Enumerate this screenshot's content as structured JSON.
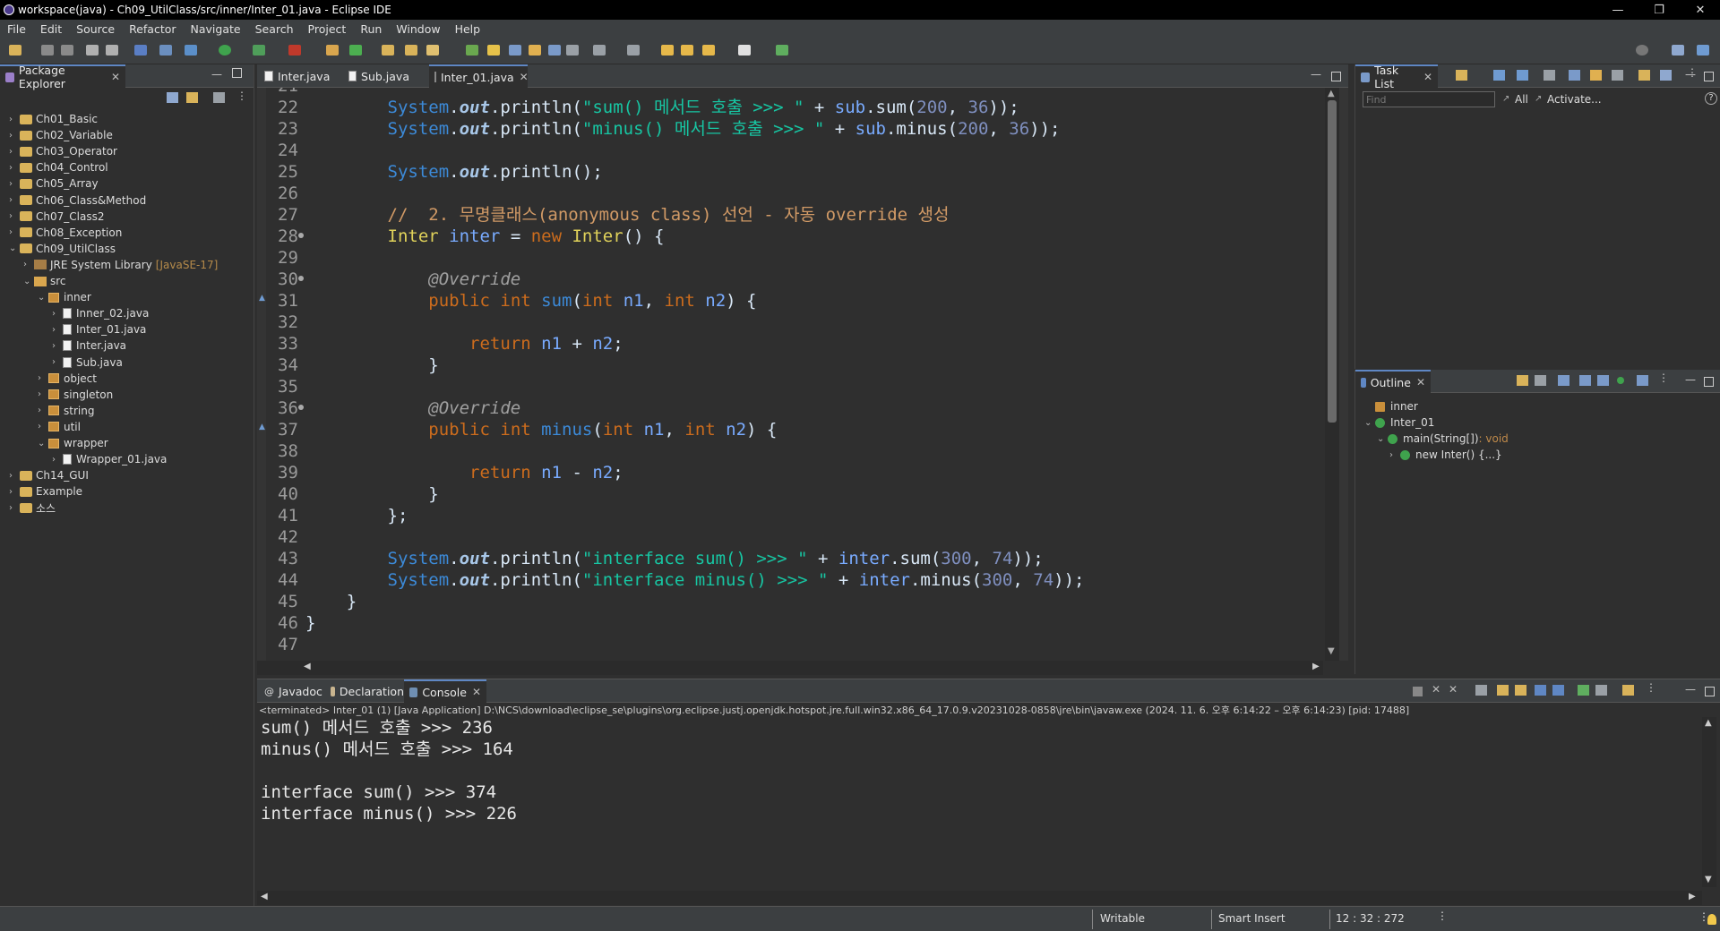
{
  "window": {
    "title": "workspace(java) - Ch09_UtilClass/src/inner/Inter_01.java - Eclipse IDE",
    "minimize": "—",
    "maximize": "❐",
    "close": "✕"
  },
  "menu": [
    "File",
    "Edit",
    "Source",
    "Refactor",
    "Navigate",
    "Search",
    "Project",
    "Run",
    "Window",
    "Help"
  ],
  "package_explorer": {
    "title": "Package Explorer",
    "items": [
      {
        "label": "Ch01_Basic",
        "type": "project",
        "expanded": false
      },
      {
        "label": "Ch02_Variable",
        "type": "project",
        "expanded": false
      },
      {
        "label": "Ch03_Operator",
        "type": "project",
        "expanded": false
      },
      {
        "label": "Ch04_Control",
        "type": "project",
        "expanded": false
      },
      {
        "label": "Ch05_Array",
        "type": "project",
        "expanded": false
      },
      {
        "label": "Ch06_Class&Method",
        "type": "project",
        "expanded": false
      },
      {
        "label": "Ch07_Class2",
        "type": "project",
        "expanded": false
      },
      {
        "label": "Ch08_Exception",
        "type": "project",
        "expanded": false
      },
      {
        "label": "Ch09_UtilClass",
        "type": "project",
        "expanded": true
      },
      {
        "label": "JRE System Library",
        "suffix": "[JavaSE-17]",
        "type": "jre",
        "expanded": false
      },
      {
        "label": "src",
        "type": "src",
        "expanded": true
      },
      {
        "label": "inner",
        "type": "package",
        "expanded": true
      },
      {
        "label": "Inner_02.java",
        "type": "file",
        "expanded": false
      },
      {
        "label": "Inter_01.java",
        "type": "file",
        "expanded": false
      },
      {
        "label": "Inter.java",
        "type": "file",
        "expanded": false
      },
      {
        "label": "Sub.java",
        "type": "file",
        "expanded": false
      },
      {
        "label": "object",
        "type": "package",
        "expanded": false
      },
      {
        "label": "singleton",
        "type": "package",
        "expanded": false
      },
      {
        "label": "string",
        "type": "package",
        "expanded": false
      },
      {
        "label": "util",
        "type": "package",
        "expanded": false
      },
      {
        "label": "wrapper",
        "type": "package",
        "expanded": true
      },
      {
        "label": "Wrapper_01.java",
        "type": "file",
        "expanded": false
      },
      {
        "label": "Ch14_GUI",
        "type": "project",
        "expanded": false
      },
      {
        "label": "Example",
        "type": "project",
        "expanded": false
      },
      {
        "label": "소스",
        "type": "project",
        "expanded": false
      }
    ]
  },
  "editor_tabs": [
    "Inter.java",
    "Sub.java",
    "Inter_01.java"
  ],
  "code_lines": [
    {
      "n": "21",
      "tokens": []
    },
    {
      "n": "22",
      "tokens": [
        [
          "        ",
          ""
        ],
        [
          "System",
          "cls"
        ],
        [
          ".",
          ""
        ],
        [
          "out",
          "fld"
        ],
        [
          ".println(",
          ""
        ],
        [
          "\"sum() 메서드 호출 >>> \"",
          "str"
        ],
        [
          " + ",
          ""
        ],
        [
          "sub",
          "var"
        ],
        [
          ".sum(",
          ""
        ],
        [
          "200",
          "num"
        ],
        [
          ", ",
          ""
        ],
        [
          "36",
          "num"
        ],
        [
          "));",
          ""
        ]
      ]
    },
    {
      "n": "23",
      "tokens": [
        [
          "        ",
          ""
        ],
        [
          "System",
          "cls"
        ],
        [
          ".",
          ""
        ],
        [
          "out",
          "fld"
        ],
        [
          ".println(",
          ""
        ],
        [
          "\"minus() 메서드 호출 >>> \"",
          "str"
        ],
        [
          " + ",
          ""
        ],
        [
          "sub",
          "var"
        ],
        [
          ".minus(",
          ""
        ],
        [
          "200",
          "num"
        ],
        [
          ", ",
          ""
        ],
        [
          "36",
          "num"
        ],
        [
          "));",
          ""
        ]
      ]
    },
    {
      "n": "24",
      "tokens": []
    },
    {
      "n": "25",
      "tokens": [
        [
          "        ",
          ""
        ],
        [
          "System",
          "cls"
        ],
        [
          ".",
          ""
        ],
        [
          "out",
          "fld"
        ],
        [
          ".println();",
          ""
        ]
      ]
    },
    {
      "n": "26",
      "tokens": []
    },
    {
      "n": "27",
      "tokens": [
        [
          "        ",
          ""
        ],
        [
          "//  2. 무명클래스(anonymous class) 선언 - 자동 override 생성",
          "com"
        ]
      ]
    },
    {
      "n": "28",
      "tokens": [
        [
          "        ",
          ""
        ],
        [
          "Inter",
          "type"
        ],
        [
          " ",
          ""
        ],
        [
          "inter",
          "var"
        ],
        [
          " = ",
          ""
        ],
        [
          "new",
          "kw"
        ],
        [
          " ",
          ""
        ],
        [
          "Inter",
          "type"
        ],
        [
          "() {",
          ""
        ]
      ]
    },
    {
      "n": "29",
      "tokens": []
    },
    {
      "n": "30",
      "tokens": [
        [
          "            ",
          ""
        ],
        [
          "@Override",
          "ann"
        ]
      ]
    },
    {
      "n": "31",
      "tokens": [
        [
          "            ",
          ""
        ],
        [
          "public",
          "kw"
        ],
        [
          " ",
          ""
        ],
        [
          "int",
          "kw"
        ],
        [
          " ",
          ""
        ],
        [
          "sum",
          "cls"
        ],
        [
          "(",
          ""
        ],
        [
          "int",
          "kw"
        ],
        [
          " ",
          ""
        ],
        [
          "n1",
          "var"
        ],
        [
          ", ",
          ""
        ],
        [
          "int",
          "kw"
        ],
        [
          " ",
          ""
        ],
        [
          "n2",
          "var"
        ],
        [
          ") {",
          ""
        ]
      ]
    },
    {
      "n": "32",
      "tokens": []
    },
    {
      "n": "33",
      "tokens": [
        [
          "                ",
          ""
        ],
        [
          "return",
          "kw"
        ],
        [
          " ",
          ""
        ],
        [
          "n1",
          "var"
        ],
        [
          " + ",
          ""
        ],
        [
          "n2",
          "var"
        ],
        [
          ";",
          ""
        ]
      ]
    },
    {
      "n": "34",
      "tokens": [
        [
          "            }",
          ""
        ]
      ]
    },
    {
      "n": "35",
      "tokens": []
    },
    {
      "n": "36",
      "tokens": [
        [
          "            ",
          ""
        ],
        [
          "@Override",
          "ann"
        ]
      ]
    },
    {
      "n": "37",
      "tokens": [
        [
          "            ",
          ""
        ],
        [
          "public",
          "kw"
        ],
        [
          " ",
          ""
        ],
        [
          "int",
          "kw"
        ],
        [
          " ",
          ""
        ],
        [
          "minus",
          "cls"
        ],
        [
          "(",
          ""
        ],
        [
          "int",
          "kw"
        ],
        [
          " ",
          ""
        ],
        [
          "n1",
          "var"
        ],
        [
          ", ",
          ""
        ],
        [
          "int",
          "kw"
        ],
        [
          " ",
          ""
        ],
        [
          "n2",
          "var"
        ],
        [
          ") {",
          ""
        ]
      ]
    },
    {
      "n": "38",
      "tokens": []
    },
    {
      "n": "39",
      "tokens": [
        [
          "                ",
          ""
        ],
        [
          "return",
          "kw"
        ],
        [
          " ",
          ""
        ],
        [
          "n1",
          "var"
        ],
        [
          " - ",
          ""
        ],
        [
          "n2",
          "var"
        ],
        [
          ";",
          ""
        ]
      ]
    },
    {
      "n": "40",
      "tokens": [
        [
          "            }",
          ""
        ]
      ]
    },
    {
      "n": "41",
      "tokens": [
        [
          "        };",
          ""
        ]
      ]
    },
    {
      "n": "42",
      "tokens": []
    },
    {
      "n": "43",
      "tokens": [
        [
          "        ",
          ""
        ],
        [
          "System",
          "cls"
        ],
        [
          ".",
          ""
        ],
        [
          "out",
          "fld"
        ],
        [
          ".println(",
          ""
        ],
        [
          "\"interface sum() >>> \"",
          "str"
        ],
        [
          " + ",
          ""
        ],
        [
          "inter",
          "var"
        ],
        [
          ".sum(",
          ""
        ],
        [
          "300",
          "num"
        ],
        [
          ", ",
          ""
        ],
        [
          "74",
          "num"
        ],
        [
          "));",
          ""
        ]
      ]
    },
    {
      "n": "44",
      "tokens": [
        [
          "        ",
          ""
        ],
        [
          "System",
          "cls"
        ],
        [
          ".",
          ""
        ],
        [
          "out",
          "fld"
        ],
        [
          ".println(",
          ""
        ],
        [
          "\"interface minus() >>> \"",
          "str"
        ],
        [
          " + ",
          ""
        ],
        [
          "inter",
          "var"
        ],
        [
          ".minus(",
          ""
        ],
        [
          "300",
          "num"
        ],
        [
          ", ",
          ""
        ],
        [
          "74",
          "num"
        ],
        [
          "));",
          ""
        ]
      ]
    },
    {
      "n": "45",
      "tokens": [
        [
          "    }",
          ""
        ]
      ]
    },
    {
      "n": "46",
      "tokens": [
        [
          "}",
          ""
        ]
      ]
    },
    {
      "n": "47",
      "tokens": []
    }
  ],
  "task_list": {
    "title": "Task List",
    "find_placeholder": "Find",
    "all": "All",
    "activate": "Activate..."
  },
  "outline": {
    "title": "Outline",
    "items": [
      {
        "label": "inner",
        "sub": ""
      },
      {
        "label": "Inter_01",
        "sub": ""
      },
      {
        "label": "main(String[])",
        "sub": " : void"
      },
      {
        "label": "new Inter() {...}",
        "sub": ""
      }
    ]
  },
  "bottom_tabs": [
    "Javadoc",
    "Declaration",
    "Console"
  ],
  "console": {
    "header": "<terminated> Inter_01 (1) [Java Application] D:\\NCS\\download\\eclipse_se\\plugins\\org.eclipse.justj.openjdk.hotspot.jre.full.win32.x86_64_17.0.9.v20231028-0858\\jre\\bin\\javaw.exe  (2024. 11. 6. 오후 6:14:22 – 오후 6:14:23) [pid: 17488]",
    "lines": [
      "sum() 메서드 호출 >>> 236",
      "minus() 메서드 호출 >>> 164",
      "",
      "interface sum() >>> 374",
      "interface minus() >>> 226"
    ]
  },
  "status": {
    "mode": "Writable",
    "insert": "Smart Insert",
    "position": "12 : 32 : 272"
  }
}
